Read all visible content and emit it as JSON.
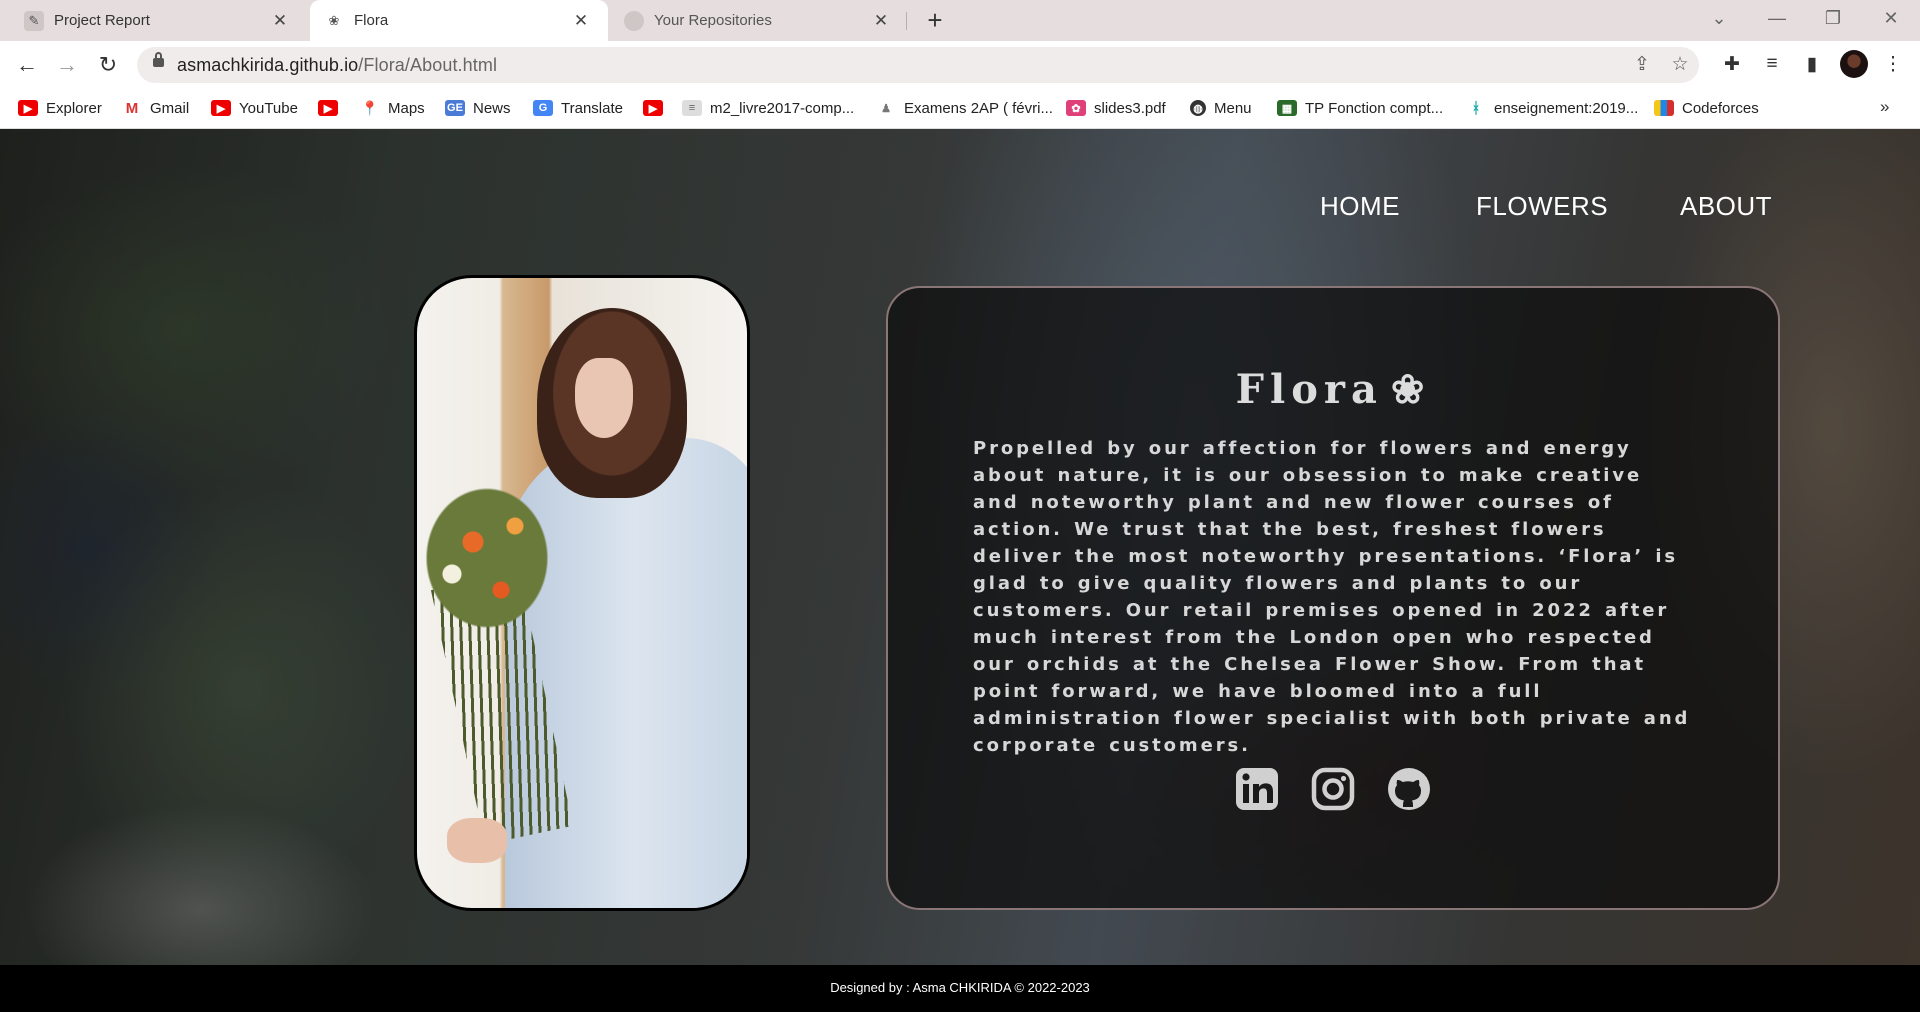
{
  "browser": {
    "tabs": [
      {
        "title": "Project Report",
        "active": false
      },
      {
        "title": "Flora",
        "active": true
      },
      {
        "title": "Your Repositories",
        "active": false
      }
    ],
    "url_host": "asmachkirida.github.io",
    "url_path": "/Flora/About.html",
    "bookmarks": [
      {
        "label": "Explorer",
        "icon": "youtube-icon"
      },
      {
        "label": "Gmail",
        "icon": "gmail-icon"
      },
      {
        "label": "YouTube",
        "icon": "youtube-icon"
      },
      {
        "label": "",
        "icon": "youtube-icon"
      },
      {
        "label": "Maps",
        "icon": "maps-icon"
      },
      {
        "label": "News",
        "icon": "news-icon"
      },
      {
        "label": "Translate",
        "icon": "translate-icon"
      },
      {
        "label": "",
        "icon": "youtube-icon"
      },
      {
        "label": "m2_livre2017-comp...",
        "icon": "doc-icon"
      },
      {
        "label": "Examens 2AP ( févri...",
        "icon": "doc-icon"
      },
      {
        "label": "slides3.pdf",
        "icon": "pdf-icon"
      },
      {
        "label": "Menu",
        "icon": "globe-icon"
      },
      {
        "label": "TP Fonction compt...",
        "icon": "doc-icon"
      },
      {
        "label": "enseignement:2019...",
        "icon": "doc-icon"
      },
      {
        "label": "Codeforces",
        "icon": "codeforces-icon"
      }
    ]
  },
  "site": {
    "nav": {
      "home": "HOME",
      "flowers": "FLOWERS",
      "about": "ABOUT"
    },
    "card": {
      "title": "Flora",
      "title_icon": "❀",
      "text": "Propelled by our affection for flowers and energy about nature, it is our obsession to make creative and noteworthy plant and new flower courses of action. We trust that the best, freshest flowers deliver the most noteworthy presentations. ‘Flora’ is glad to give quality flowers and plants to our customers. Our retail premises opened in 2022 after much interest from the London open who respected our orchids at the Chelsea Flower Show. From that point forward, we have bloomed into a full administration flower specialist with both private and corporate customers."
    },
    "socials": [
      "linkedin-icon",
      "instagram-icon",
      "github-icon"
    ],
    "footer": "Designed by : Asma CHKIRIDA © 2022-2023"
  },
  "colors": {
    "card_border": "#8a7676",
    "card_text": "#d7d7d7",
    "footer_bg": "#000000",
    "tabstrip_bg": "#e6dede"
  }
}
